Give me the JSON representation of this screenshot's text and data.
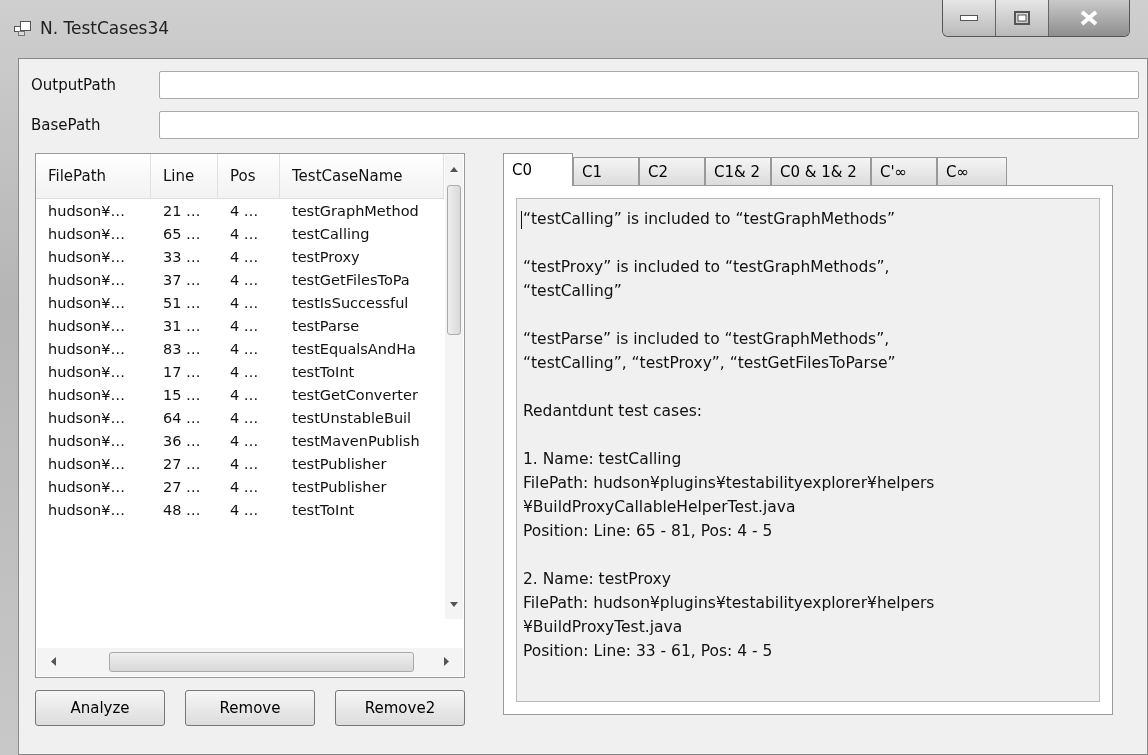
{
  "window": {
    "title": "N. TestCases34"
  },
  "fields": [
    {
      "label": "OutputPath"
    },
    {
      "label": "BasePath"
    }
  ],
  "table": {
    "columns": [
      "FilePath",
      "Line",
      "Pos",
      "TestCaseName"
    ],
    "rows": [
      [
        "hudson¥…",
        "21 …",
        "4 …",
        "testGraphMethod"
      ],
      [
        "hudson¥…",
        "65 …",
        "4 …",
        "testCalling"
      ],
      [
        "hudson¥…",
        "33 …",
        "4 …",
        "testProxy"
      ],
      [
        "hudson¥…",
        "37 …",
        "4 …",
        "testGetFilesToPa"
      ],
      [
        "hudson¥…",
        "51 …",
        "4 …",
        "testIsSuccessful"
      ],
      [
        "hudson¥…",
        "31 …",
        "4 …",
        "testParse"
      ],
      [
        "hudson¥…",
        "83 …",
        "4 …",
        "testEqualsAndHa"
      ],
      [
        "hudson¥…",
        "17 …",
        "4 …",
        "testToInt"
      ],
      [
        "hudson¥…",
        "15 …",
        "4 …",
        "testGetConverter"
      ],
      [
        "hudson¥…",
        "64 …",
        "4 …",
        "testUnstableBuil"
      ],
      [
        "hudson¥…",
        "36 …",
        "4 …",
        "testMavenPublish"
      ],
      [
        "hudson¥…",
        "27 …",
        "4 …",
        "testPublisher"
      ],
      [
        "hudson¥…",
        "27 …",
        "4 …",
        "testPublisher"
      ],
      [
        "hudson¥…",
        "48 …",
        "4 …",
        "testToInt"
      ]
    ]
  },
  "buttons": [
    "Analyze",
    "Remove",
    "Remove2"
  ],
  "tabs": [
    {
      "label": "C0",
      "selected": true
    },
    {
      "label": "C1",
      "selected": false
    },
    {
      "label": "C2",
      "selected": false
    },
    {
      "label": "C1& 2",
      "selected": false
    },
    {
      "label": "C0 & 1& 2",
      "selected": false
    },
    {
      "label": "C'∞",
      "selected": false
    },
    {
      "label": "C∞",
      "selected": false
    }
  ],
  "output": {
    "paragraphs": [
      [
        "“testCalling” is included to “testGraphMethods”"
      ],
      [
        "“testProxy” is included to “testGraphMethods”,",
        "“testCalling”"
      ],
      [
        "“testParse” is included to “testGraphMethods”,",
        "“testCalling”, “testProxy”, “testGetFilesToParse”"
      ],
      [
        "Redantdunt test cases:"
      ],
      [
        "1. Name: testCalling",
        "FilePath: hudson¥plugins¥testabilityexplorer¥helpers",
        "¥BuildProxyCallableHelperTest.java",
        "Position: Line: 65 - 81, Pos: 4 - 5"
      ],
      [
        "2. Name: testProxy",
        "FilePath: hudson¥plugins¥testabilityexplorer¥helpers",
        "¥BuildProxyTest.java",
        "Position: Line: 33 - 61, Pos: 4 - 5"
      ]
    ]
  }
}
